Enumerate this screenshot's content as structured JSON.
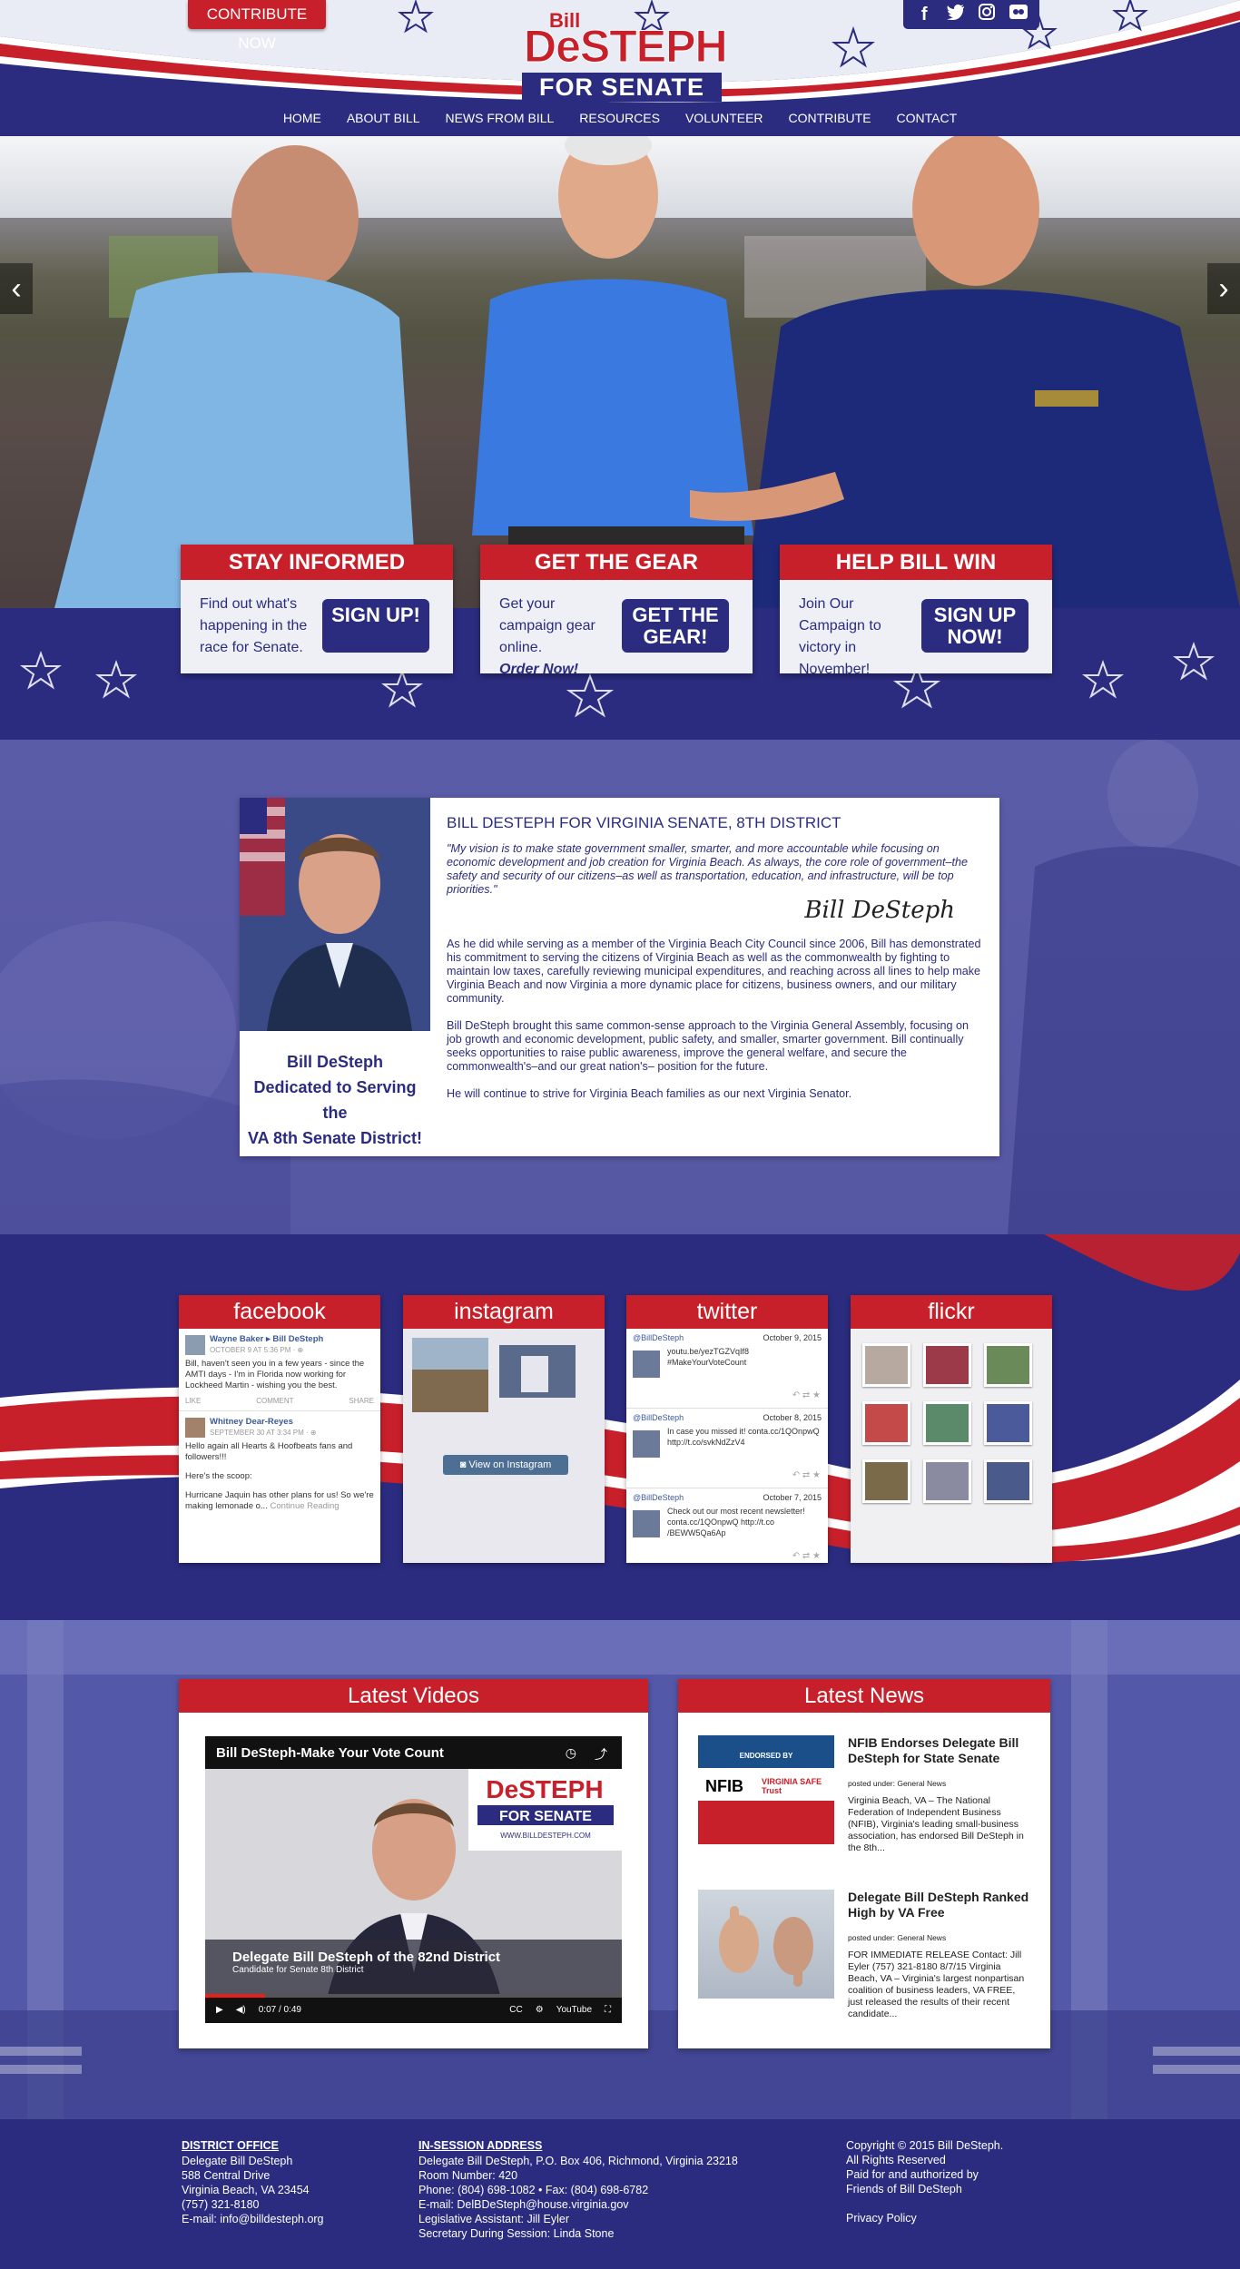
{
  "header": {
    "contribute": "CONTRIBUTE NOW",
    "logo": {
      "first": "Bill",
      "last": "DeSTEPH",
      "tagline": "FOR SENATE"
    },
    "social_icons": [
      "facebook-icon",
      "twitter-icon",
      "instagram-icon",
      "flickr-icon"
    ],
    "nav": [
      "HOME",
      "ABOUT BILL",
      "NEWS FROM BILL",
      "RESOURCES",
      "VOLUNTEER",
      "CONTRIBUTE",
      "CONTACT"
    ]
  },
  "hero": {
    "prev": "‹",
    "next": "›"
  },
  "cta": [
    {
      "heading": "STAY INFORMED",
      "text": "Find out what's happening in the race for Senate.",
      "button": "SIGN UP!"
    },
    {
      "heading": "GET THE GEAR",
      "text": "Get your campaign gear online.",
      "text_em": "Order Now!",
      "button": "GET THE GEAR!"
    },
    {
      "heading": "HELP BILL WIN",
      "text": "Join Our Campaign to victory in November!",
      "button": "SIGN UP NOW!"
    }
  ],
  "bio": {
    "caption": [
      "Bill DeSteph",
      "Dedicated to Serving the",
      "VA 8th Senate District!"
    ],
    "title": "BILL DESTEPH FOR VIRGINIA SENATE, 8TH DISTRICT",
    "quote": "\"My vision is to make state government smaller, smarter, and more accountable while focusing on economic development and job creation for Virginia Beach. As always, the core role of government–the safety and security of our citizens–as well as transportation, education, and infrastructure, will be top priorities.\"",
    "signature": "Bill DeSteph",
    "paragraphs": [
      "As he did while serving as a member of the Virginia Beach City Council since 2006, Bill has demonstrated his commitment to serving the citizens of Virginia Beach as well as the commonwealth by fighting to maintain low taxes, carefully reviewing municipal expenditures, and reaching across all lines to help make Virginia Beach and now Virginia a more dynamic place for citizens, business owners, and our military community.",
      "Bill DeSteph brought this same common-sense approach to the Virginia General Assembly, focusing on job growth and economic development, public safety, and smaller, smarter government. Bill continually seeks opportunities to raise public awareness, improve the general welfare, and secure the commonwealth's–and our great nation's– position for the future.",
      "He will continue to strive for Virginia Beach families as our next Virginia Senator."
    ]
  },
  "feeds": {
    "facebook": {
      "title": "facebook",
      "posts": [
        {
          "author": "Wayne Baker ▸ Bill DeSteph",
          "date": "OCTOBER 9 AT 5:36 PM · ⊕",
          "text": "Bill, haven't seen you in a few years - since the AMTI days - I'm in Florida now working for Lockheed Martin - wishing you the best.",
          "actions": [
            "LIKE",
            "COMMENT",
            "SHARE"
          ]
        },
        {
          "author": "Whitney Dear-Reyes",
          "date": "SEPTEMBER 30 AT 3:34 PM · ⊕",
          "text": "Hello again all Hearts & Hoofbeats fans and followers!!!",
          "text2": "Here's the scoop:",
          "text3": "Hurricane Jaquin has other plans for us! So we're making lemonade o...",
          "more": "Continue Reading"
        }
      ]
    },
    "instagram": {
      "title": "instagram",
      "button": "View on Instagram"
    },
    "twitter": {
      "title": "twitter",
      "tweets": [
        {
          "handle": "@BillDeSteph",
          "date": "October 9, 2015",
          "text": "youtu.be/yezTGZVqIf8 #MakeYourVoteCount"
        },
        {
          "handle": "@BillDeSteph",
          "date": "October 8, 2015",
          "text": "In case you missed it! conta.cc/1QOnpwQ http://t.co/svkNdZzV4"
        },
        {
          "handle": "@BillDeSteph",
          "date": "October 7, 2015",
          "text": "Check out our most recent newsletter! conta.cc/1QOnpwQ http://t.co /BEWW5Qa6Ap"
        }
      ],
      "icons": "↶  ⇄  ★"
    },
    "flickr": {
      "title": "flickr"
    }
  },
  "videos": {
    "title": "Latest Videos",
    "video_title": "Bill DeSteph-Make Your Vote Count",
    "lower_third": "Delegate Bill DeSteph of the 82nd District",
    "lower_sub": "Candidate for Senate 8th District",
    "logo_url": "WWW.BILLDESTEPH.COM",
    "time": "0:07 / 0:49"
  },
  "news": {
    "title": "Latest News",
    "items": [
      {
        "title": "NFIB Endorses Delegate Bill DeSteph for State Senate",
        "category": "posted under: General News",
        "body": "Virginia Beach, VA – The National Federation of Independent Business (NFIB), Virginia's leading small-business association, has endorsed Bill DeSteph in the 8th...",
        "thumb_text": "ENDORSED BY",
        "thumb_brand": "NFIB",
        "thumb_sub": "VIRGINIA SAFE Trust"
      },
      {
        "title": "Delegate Bill DeSteph Ranked High by VA Free",
        "category": "posted under: General News",
        "body": "FOR IMMEDIATE RELEASE Contact: Jill Eyler (757) 321-8180 8/7/15 Virginia Beach, VA – Virginia's largest nonpartisan coalition of business leaders, VA FREE, just released the results of their recent candidate..."
      }
    ]
  },
  "footer": {
    "district": {
      "heading": "DISTRICT OFFICE",
      "lines": [
        "Delegate Bill DeSteph",
        "588 Central Drive",
        "Virginia Beach, VA 23454",
        "(757) 321-8180",
        "E-mail: info@billdesteph.org"
      ]
    },
    "session": {
      "heading": "IN-SESSION ADDRESS",
      "lines": [
        "Delegate Bill DeSteph, P.O. Box 406, Richmond, Virginia 23218",
        "Room Number: 420",
        "Phone: (804) 698-1082 • Fax: (804) 698-6782",
        "E-mail: DelBDeSteph@house.virginia.gov",
        "Legislative Assistant: Jill Eyler",
        "Secretary During Session: Linda Stone"
      ]
    },
    "copyright": [
      "Copyright © 2015 Bill DeSteph.",
      "All Rights Reserved",
      "Paid for and authorized by",
      "Friends of Bill DeSteph"
    ],
    "privacy": "Privacy Policy"
  },
  "colors": {
    "brand_blue": "#2b2c7f",
    "brand_red": "#c8202a"
  }
}
